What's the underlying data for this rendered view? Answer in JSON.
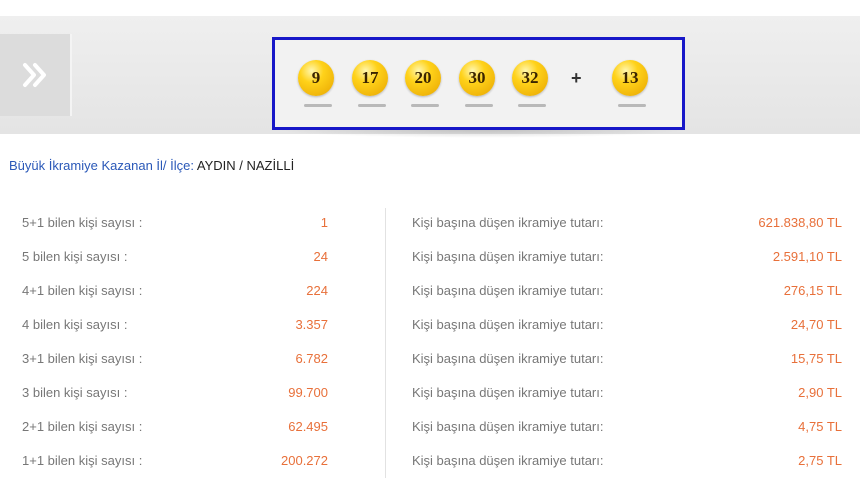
{
  "draw": {
    "numbers": [
      "9",
      "17",
      "20",
      "30",
      "32"
    ],
    "plus_sign": "+",
    "bonus": "13",
    "ball_color": "#ffd21a",
    "box_border_color": "#1717c8"
  },
  "nav": {
    "arrow_icon": "double-chevron-right-icon"
  },
  "winner": {
    "label": "Büyük İkramiye Kazanan İl/ İlçe:",
    "place": "AYDIN / NAZİLLİ"
  },
  "results": [
    {
      "label": "5+1 bilen kişi sayısı :",
      "count": "1",
      "prize_label": "Kişi başına düşen ikramiye tutarı:",
      "prize": "621.838,80 TL"
    },
    {
      "label": "5 bilen kişi sayısı :",
      "count": "24",
      "prize_label": "Kişi başına düşen ikramiye tutarı:",
      "prize": "2.591,10 TL"
    },
    {
      "label": "4+1 bilen kişi sayısı :",
      "count": "224",
      "prize_label": "Kişi başına düşen ikramiye tutarı:",
      "prize": "276,15 TL"
    },
    {
      "label": "4 bilen kişi sayısı :",
      "count": "3.357",
      "prize_label": "Kişi başına düşen ikramiye tutarı:",
      "prize": "24,70 TL"
    },
    {
      "label": "3+1 bilen kişi sayısı :",
      "count": "6.782",
      "prize_label": "Kişi başına düşen ikramiye tutarı:",
      "prize": "15,75 TL"
    },
    {
      "label": "3 bilen kişi sayısı :",
      "count": "99.700",
      "prize_label": "Kişi başına düşen ikramiye tutarı:",
      "prize": "2,90 TL"
    },
    {
      "label": "2+1 bilen kişi sayısı :",
      "count": "62.495",
      "prize_label": "Kişi başına düşen ikramiye tutarı:",
      "prize": "4,75 TL"
    },
    {
      "label": "1+1 bilen kişi sayısı :",
      "count": "200.272",
      "prize_label": "Kişi başına düşen ikramiye tutarı:",
      "prize": "2,75 TL"
    }
  ],
  "colors": {
    "accent_value": "#e8703a",
    "link_blue": "#2a58b8"
  }
}
